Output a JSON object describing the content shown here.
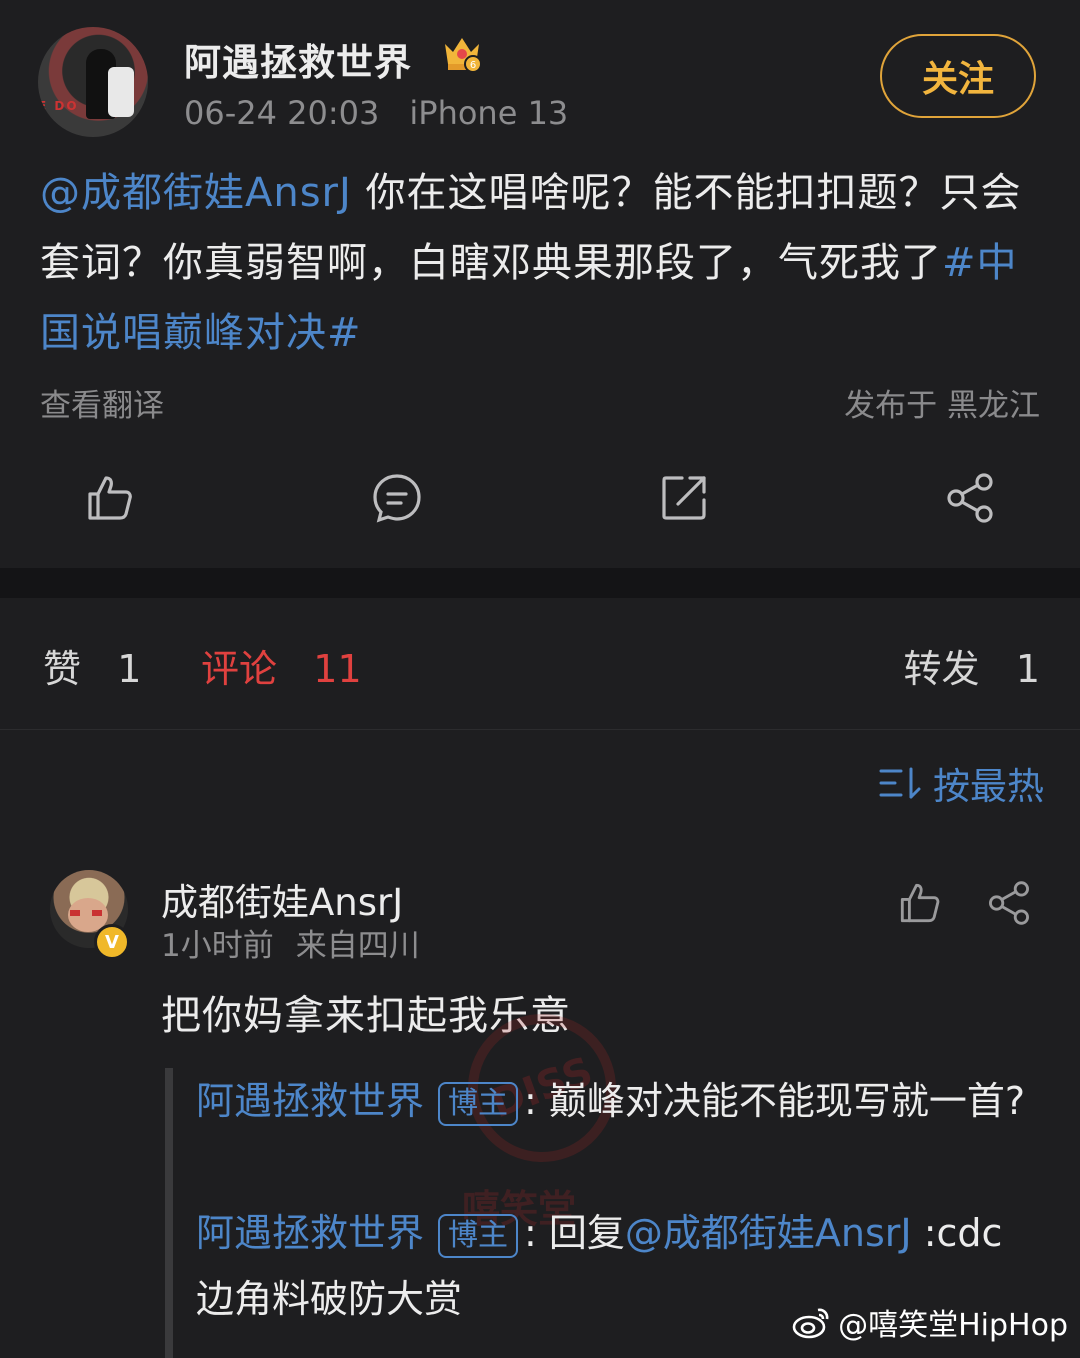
{
  "post": {
    "author": "阿遇拯救世界",
    "date": "06-24 20:03",
    "device": "iPhone 13",
    "follow_label": "关注",
    "mention": "@成都街娃AnsrJ",
    "body_line_main": " 你在这唱啥呢？能不能扣扣题？只会套词？你真弱智啊，白瞎邓典果那段了，气死我了",
    "topic": "#中国说唱巅峰对决#",
    "translate_label": "查看翻译",
    "location": "发布于 黑龙江",
    "actions": [
      "like-icon",
      "comment-icon",
      "repost-icon",
      "share-icon"
    ]
  },
  "avatar_text": "E DO",
  "stats": {
    "likes_label": "赞",
    "likes_count": "1",
    "comments_label": "评论",
    "comments_count": "11",
    "reposts_label": "转发",
    "reposts_count": "1"
  },
  "sort": {
    "label": "按最热",
    "icon": "sort-icon"
  },
  "comment": {
    "author": "成都街娃AnsrJ",
    "badge": "V",
    "time": "1小时前",
    "source": "来自四川",
    "text": "把你妈拿来扣起我乐意",
    "replies": [
      {
        "author": "阿遇拯救世界",
        "tag": "博主",
        "text": "巅峰对决能不能现写就一首?"
      },
      {
        "author": "阿遇拯救世界",
        "tag": "博主",
        "prefix": "回复",
        "mention": "@成都街娃AnsrJ",
        "text": ":cdc边角料破防大赏"
      }
    ]
  },
  "watermark": {
    "seal": "DISS",
    "text": "嘻笑堂",
    "handle": "@嘻笑堂HipHop"
  },
  "colors": {
    "background": "#1e1e20",
    "link": "#4d86c9",
    "follow": "#f2b53e",
    "active_tab": "#e0413f"
  }
}
